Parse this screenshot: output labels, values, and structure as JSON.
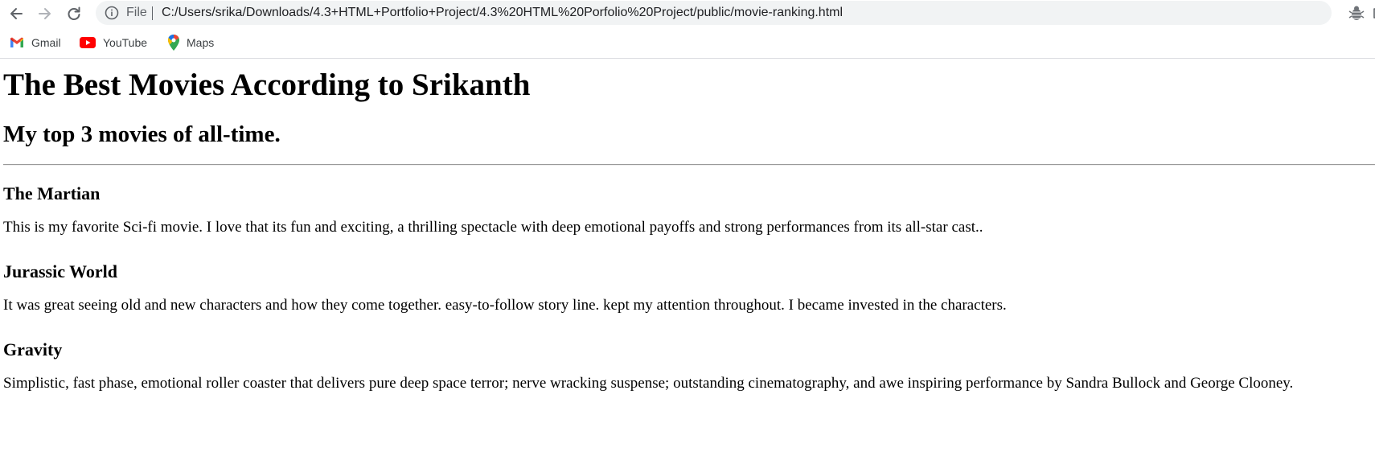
{
  "browser": {
    "omnibox": {
      "site_chip": "File",
      "url": "C:/Users/srika/Downloads/4.3+HTML+Portfolio+Project/4.3%20HTML%20Porfolio%20Project/public/movie-ranking.html"
    },
    "icons": {
      "back": "back-arrow-icon",
      "forward": "forward-arrow-icon",
      "reload": "reload-icon",
      "info": "info-icon",
      "share": "share-icon",
      "bookmark": "star-icon",
      "extension": "extension-icon"
    },
    "bookmarks": [
      {
        "label": "Gmail",
        "icon": "gmail-icon"
      },
      {
        "label": "YouTube",
        "icon": "youtube-icon"
      },
      {
        "label": "Maps",
        "icon": "maps-icon"
      }
    ]
  },
  "page": {
    "title": "The Best Movies According to Srikanth",
    "subtitle": "My top 3 movies of all-time.",
    "movies": [
      {
        "title": "The Martian",
        "description": "This is my favorite Sci-fi movie. I love that its fun and exciting, a thrilling spectacle with deep emotional payoffs and strong performances from its all-star cast.."
      },
      {
        "title": "Jurassic World",
        "description": "It was great seeing old and new characters and how they come together. easy-to-follow story line. kept my attention throughout. I became invested in the characters."
      },
      {
        "title": "Gravity",
        "description": "Simplistic, fast phase, emotional roller coaster that delivers pure deep space terror; nerve wracking suspense; outstanding cinematography, and awe inspiring performance by Sandra Bullock and George Clooney."
      }
    ]
  }
}
